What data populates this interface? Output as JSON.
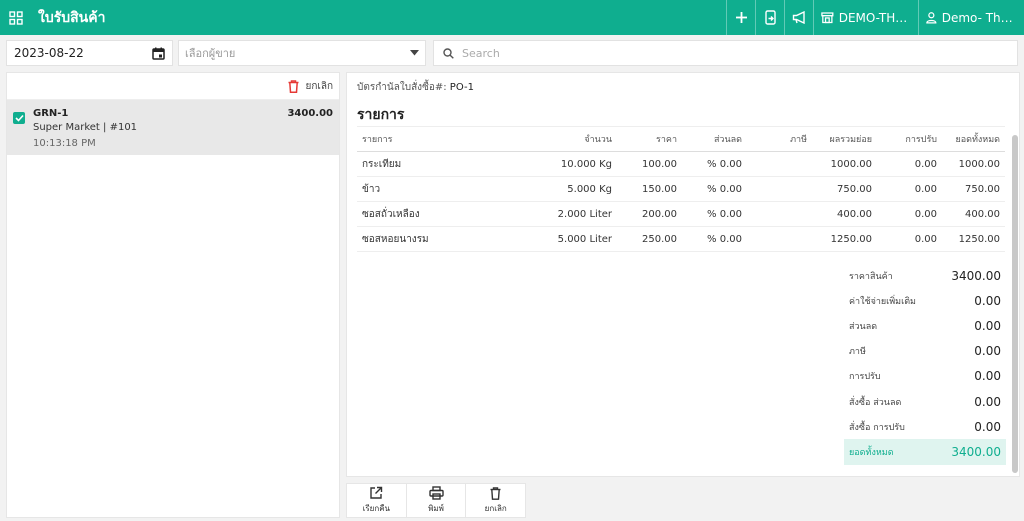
{
  "app": {
    "title": "ใบรับสินค้า"
  },
  "topbar": {
    "store_label": "DEMO-THAI...",
    "user_label": "Demo- Thail..."
  },
  "filters": {
    "date": "2023-08-22",
    "vendor_placeholder": "เลือกผู้ขาย",
    "search_placeholder": "Search"
  },
  "left": {
    "cancel_label": "ยกเลิก",
    "items": [
      {
        "no": "GRN-1",
        "sub": "Super Market | #101",
        "time": "10:13:18 PM",
        "amount": "3400.00",
        "checked": true
      }
    ]
  },
  "detail": {
    "po_label": "บัตรกำนัลใบสั่งซื้อ#:",
    "po_value": "PO-1",
    "section_title": "รายการ",
    "columns": [
      "รายการ",
      "จำนวน",
      "ราคา",
      "ส่วนลด",
      "ภาษี",
      "ผลรวมย่อย",
      "การปรับ",
      "ยอดทั้งหมด"
    ],
    "rows": [
      [
        "กระเทียม",
        "10.000 Kg",
        "100.00",
        "% 0.00",
        "",
        "1000.00",
        "0.00",
        "1000.00"
      ],
      [
        "ข้าว",
        "5.000 Kg",
        "150.00",
        "% 0.00",
        "",
        "750.00",
        "0.00",
        "750.00"
      ],
      [
        "ซอสถั่วเหลือง",
        "2.000 Liter",
        "200.00",
        "% 0.00",
        "",
        "400.00",
        "0.00",
        "400.00"
      ],
      [
        "ซอสหอยนางรม",
        "5.000 Liter",
        "250.00",
        "% 0.00",
        "",
        "1250.00",
        "0.00",
        "1250.00"
      ]
    ],
    "totals": [
      {
        "label": "ราคาสินค้า",
        "value": "3400.00"
      },
      {
        "label": "ค่าใช้จ่ายเพิ่มเติม",
        "value": "0.00"
      },
      {
        "label": "ส่วนลด",
        "value": "0.00"
      },
      {
        "label": "ภาษี",
        "value": "0.00"
      },
      {
        "label": "การปรับ",
        "value": "0.00"
      },
      {
        "label": "สั่งซื้อ ส่วนลด",
        "value": "0.00"
      },
      {
        "label": "สั่งซื้อ การปรับ",
        "value": "0.00"
      },
      {
        "label": "ยอดทั้งหมด",
        "value": "3400.00"
      }
    ]
  },
  "actions": {
    "return_label": "เรียกคืน",
    "print_label": "พิมพ์",
    "cancel_label": "ยกเลิก"
  },
  "colors": {
    "brand": "#0fae8f",
    "danger": "#e53935",
    "grand_bg": "#dff4ef"
  }
}
